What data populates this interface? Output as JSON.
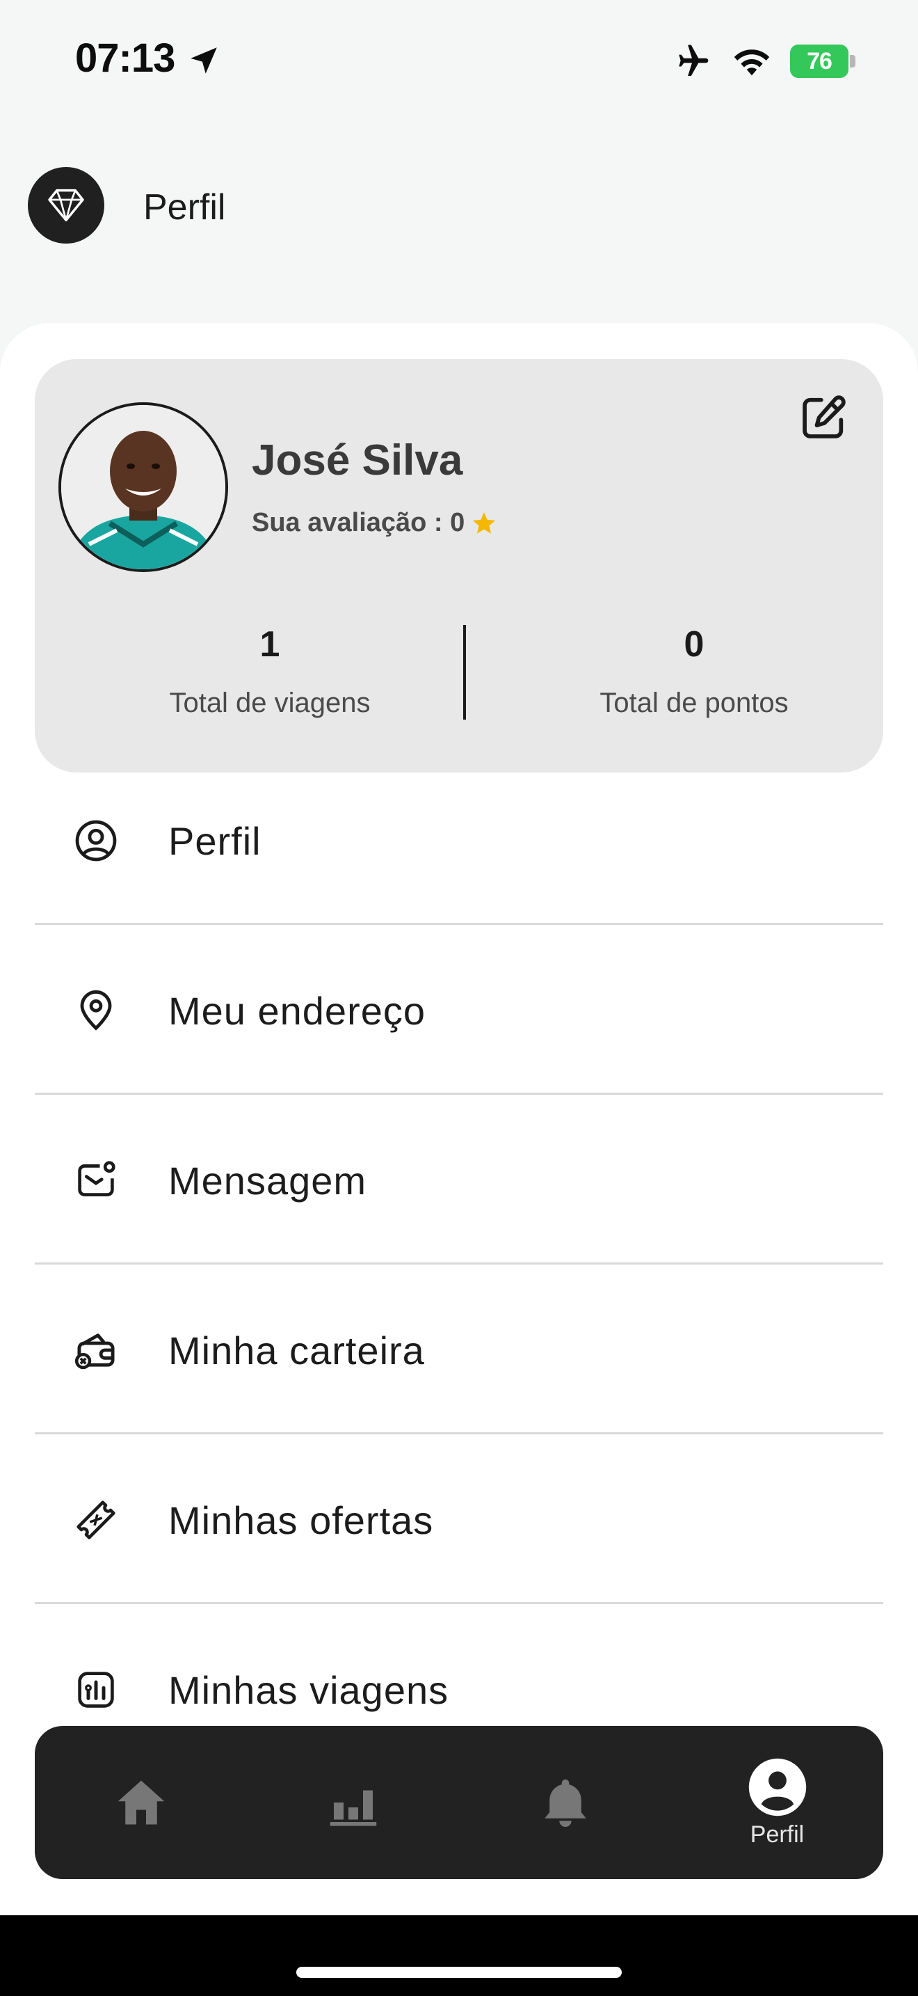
{
  "status_bar": {
    "time": "07:13",
    "battery": "76",
    "icons": [
      "location-arrow-icon",
      "airplane-icon",
      "wifi-icon",
      "battery-icon"
    ]
  },
  "header": {
    "title": "Perfil",
    "logo_icon": "diamond-logo-icon"
  },
  "profile": {
    "name": "José Silva",
    "rating_label": "Sua avaliação : 0",
    "rating_color": "#f5b800",
    "stats": [
      {
        "value": "1",
        "label": "Total de viagens"
      },
      {
        "value": "0",
        "label": "Total de pontos"
      }
    ]
  },
  "menu": [
    {
      "label": "Perfil",
      "icon": "user-circle-icon"
    },
    {
      "label": "Meu endereço",
      "icon": "location-pin-icon"
    },
    {
      "label": "Mensagem",
      "icon": "message-icon"
    },
    {
      "label": "Minha carteira",
      "icon": "wallet-icon"
    },
    {
      "label": "Minhas ofertas",
      "icon": "ticket-icon"
    },
    {
      "label": "Minhas viagens",
      "icon": "trips-chart-icon"
    }
  ],
  "bottom_nav": [
    {
      "icon": "home-icon",
      "label": ""
    },
    {
      "icon": "bar-chart-icon",
      "label": ""
    },
    {
      "icon": "bell-icon",
      "label": ""
    },
    {
      "icon": "profile-icon",
      "label": "Perfil",
      "active": true
    }
  ],
  "colors": {
    "background": "#f5f6f6",
    "card": "#e8e8e8",
    "nav_background": "#222222",
    "battery": "#34c759"
  }
}
